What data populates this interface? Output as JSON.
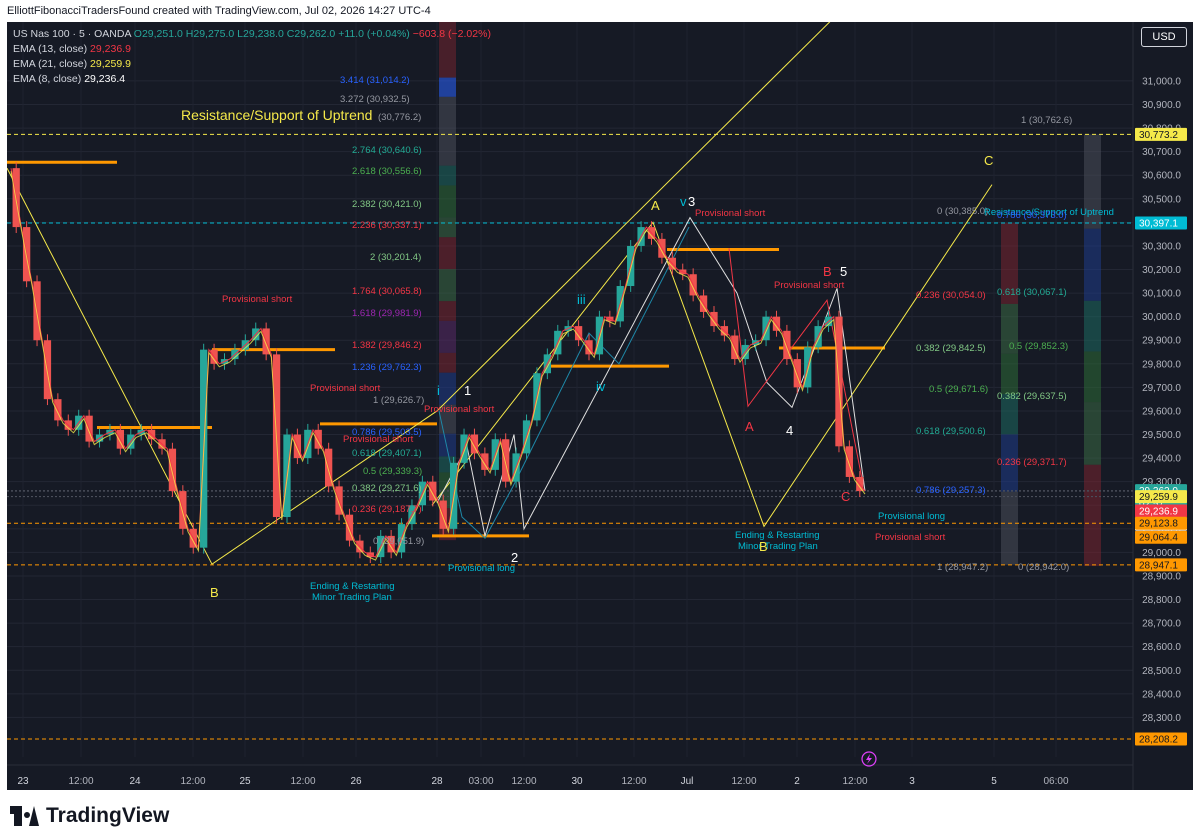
{
  "header": {
    "caption": "ElliottFibonacciTradersFound created with TradingView.com, Jul 02, 2026 14:27 UTC-4"
  },
  "legend": {
    "symbol": "US Nas 100 · 5 · OANDA",
    "ohlc": {
      "o": "O29,251.0",
      "h": "H29,275.0",
      "l": "L29,238.0",
      "c": "C29,262.0",
      "chg": "+11.0 (+0.04%)",
      "chg2": "−603.8 (−2.02%)"
    },
    "emas": [
      {
        "label": "EMA (13, close)",
        "value": "29,236.9",
        "color": "#f23645"
      },
      {
        "label": "EMA (21, close)",
        "value": "29,259.9",
        "color": "#f5e94a"
      },
      {
        "label": "EMA (8, close)",
        "value": "29,236.4",
        "color": "#ffffff"
      }
    ]
  },
  "currency_button": "USD",
  "colors": {
    "bg": "#161a25",
    "up": "#26a69a",
    "down": "#ef5350",
    "yellow": "#f5e94a",
    "orange": "#ff9800",
    "red": "#f23645",
    "blue": "#2962ff",
    "cyan": "#22ab94"
  },
  "footer": {
    "brand": "TradingView"
  },
  "chart_data": {
    "type": "line",
    "title": "",
    "ylim": [
      28132,
      31250
    ],
    "y_ticks": [
      "31,000.0",
      "30,900.0",
      "30,800.0",
      "30,700.0",
      "30,600.0",
      "30,500.0",
      "30,400.0",
      "30,300.0",
      "30,200.0",
      "30,100.0",
      "30,000.0",
      "29,900.0",
      "29,800.0",
      "29,700.0",
      "29,600.0",
      "29,500.0",
      "29,400.0",
      "29,300.0",
      "29,200.0",
      "29,100.0",
      "29,000.0",
      "28,900.0",
      "28,800.0",
      "28,700.0",
      "28,600.0",
      "28,500.0",
      "28,400.0",
      "28,300.0"
    ],
    "x_ticks": [
      "23",
      "12:00",
      "24",
      "12:00",
      "25",
      "12:00",
      "26",
      "28",
      "03:00",
      "12:00",
      "30",
      "12:00",
      "Jul",
      "12:00",
      "2",
      "12:00",
      "3",
      "5",
      "06:00"
    ],
    "price_series": {
      "name": "US Nas 100",
      "values": [
        30630,
        30380,
        30150,
        29900,
        29650,
        29560,
        29520,
        29580,
        29470,
        29500,
        29520,
        29440,
        29500,
        29520,
        29480,
        29440,
        29260,
        29100,
        29020,
        29860,
        29800,
        29820,
        29860,
        29900,
        29950,
        29840,
        29150,
        29500,
        29400,
        29520,
        29440,
        29280,
        29160,
        29050,
        29000,
        28980,
        29070,
        29000,
        29120,
        29200,
        29300,
        29220,
        29100,
        29380,
        29500,
        29420,
        29350,
        29480,
        29300,
        29420,
        29560,
        29760,
        29840,
        29940,
        29960,
        29900,
        29840,
        30000,
        29980,
        30130,
        30300,
        30380,
        30330,
        30250,
        30200,
        30180,
        30090,
        30020,
        29960,
        29920,
        29820,
        29880,
        29900,
        30000,
        29940,
        29820,
        29700,
        29870,
        29960,
        30000,
        29450,
        29320,
        29260
      ]
    },
    "horizontal_levels": [
      {
        "label": "",
        "value": 30773.2,
        "badge": "30,773.2",
        "style": "dashed-yellow"
      },
      {
        "label": "",
        "value": 30397.1,
        "badge": "30,397.1",
        "style": "dashed-cyan"
      },
      {
        "label": "",
        "value": 29262.0,
        "badge": "29,262.0",
        "badge2": "02:57",
        "style": "price"
      },
      {
        "label": "",
        "value": 29259.9,
        "badge": "29,259.9",
        "style": "ema21"
      },
      {
        "label": "",
        "value": 29236.9,
        "badge": "29,236.9",
        "style": "ema13"
      },
      {
        "label": "",
        "value": 29236.4,
        "badge": "29,236.4",
        "style": "ema8"
      },
      {
        "label": "",
        "value": 29123.8,
        "badge": "29,123.8",
        "style": "dashed-orange"
      },
      {
        "label": "",
        "value": 29064.4,
        "badge": "29,064.4",
        "style": "orange"
      },
      {
        "label": "",
        "value": 28947.1,
        "badge": "28,947.1",
        "style": "dashed-orange"
      },
      {
        "label": "",
        "value": 28208.2,
        "badge": "28,208.2",
        "style": "dashed-orange"
      }
    ],
    "text_annotations": [
      {
        "text": "Resistance/Support of Uptrend",
        "color": "#f5e94a"
      },
      {
        "text": "3.414 (31,014.2)",
        "color": "#2962ff"
      },
      {
        "text": "3.272 (30,932.5)",
        "color": "#9598a1"
      },
      {
        "text": "(30,776.2)",
        "color": "#9598a1"
      },
      {
        "text": "2.764 (30,640.6)",
        "color": "#22ab94"
      },
      {
        "text": "2.618 (30,556.6)",
        "color": "#4caf50"
      },
      {
        "text": "2.382 (30,421.0)",
        "color": "#81c784"
      },
      {
        "text": "2.236 (30,337.1)",
        "color": "#f23645"
      },
      {
        "text": "2 (30,201.4)",
        "color": "#81c784"
      },
      {
        "text": "1.764 (30,065.8)",
        "color": "#f23645"
      },
      {
        "text": "1.618 (29,981.9)",
        "color": "#9c27b0"
      },
      {
        "text": "1.382 (29,846.2)",
        "color": "#f23645"
      },
      {
        "text": "1.236 (29,762.3)",
        "color": "#2962ff"
      },
      {
        "text": "1 (29,626.7)",
        "color": "#9598a1"
      },
      {
        "text": "0.786 (29,503.5)",
        "color": "#2962ff"
      },
      {
        "text": "0.618 (29,407.1)",
        "color": "#22ab94"
      },
      {
        "text": "0.5 (29,339.3)",
        "color": "#4caf50"
      },
      {
        "text": "0.382 (29,271.6)",
        "color": "#81c784"
      },
      {
        "text": "0.236 (29,187.7)",
        "color": "#f23645"
      },
      {
        "text": "0 (29,051.9)",
        "color": "#9598a1"
      },
      {
        "text": "Provisional short",
        "color": "#f23645"
      },
      {
        "text": "Provisional short",
        "color": "#f23645"
      },
      {
        "text": "Provisional short",
        "color": "#f23645"
      },
      {
        "text": "Provisional short",
        "color": "#f23645"
      },
      {
        "text": "Provisional short",
        "color": "#f23645"
      },
      {
        "text": "Provisional short",
        "color": "#f23645"
      },
      {
        "text": "Provisional short",
        "color": "#f23645"
      },
      {
        "text": "Provisional long",
        "color": "#00bcd4"
      },
      {
        "text": "Provisional long",
        "color": "#00bcd4"
      },
      {
        "text": "Ending & Restarting",
        "color": "#00bcd4"
      },
      {
        "text": "Minor Trading Plan",
        "color": "#00bcd4"
      },
      {
        "text": "Ending & Restarting",
        "color": "#00bcd4"
      },
      {
        "text": "Minor Trading Plan",
        "color": "#00bcd4"
      },
      {
        "text": "1 (30,762.6)",
        "color": "#9598a1"
      },
      {
        "text": "0 (30,385.0)",
        "color": "#9598a1"
      },
      {
        "text": "Resistance/Support of Uptrend",
        "color": "#00bcd4"
      },
      {
        "text": "0.236 (30,054.0)",
        "color": "#f23645"
      },
      {
        "text": "0.382 (29,842.5)",
        "color": "#81c784"
      },
      {
        "text": "0.5 (29,671.6)",
        "color": "#4caf50"
      },
      {
        "text": "0.618 (29,500.6)",
        "color": "#22ab94"
      },
      {
        "text": "0.786 (29,257.3)",
        "color": "#2962ff"
      },
      {
        "text": "1 (28,947.2)",
        "color": "#9598a1"
      },
      {
        "text": "0.618 (30,067.1)",
        "color": "#22ab94"
      },
      {
        "text": "0.5 (29,852.3)",
        "color": "#4caf50"
      },
      {
        "text": "0.382 (29,637.5)",
        "color": "#81c784"
      },
      {
        "text": "0.236 (29,371.7)",
        "color": "#f23645"
      },
      {
        "text": "0 (28,942.0)",
        "color": "#9598a1"
      },
      {
        "text": "0.786 (30,373.0)",
        "color": "#2962ff"
      }
    ],
    "wave_labels": [
      {
        "text": "B",
        "color": "#f5e94a"
      },
      {
        "text": "i",
        "color": "#00bcd4"
      },
      {
        "text": "1",
        "color": "#ffffff"
      },
      {
        "text": "2",
        "color": "#ffffff"
      },
      {
        "text": "iii",
        "color": "#00bcd4"
      },
      {
        "text": "iv",
        "color": "#00bcd4"
      },
      {
        "text": "A",
        "color": "#f5e94a"
      },
      {
        "text": "v",
        "color": "#00bcd4"
      },
      {
        "text": "3",
        "color": "#ffffff"
      },
      {
        "text": "A",
        "color": "#f23645"
      },
      {
        "text": "4",
        "color": "#ffffff"
      },
      {
        "text": "B",
        "color": "#f23645"
      },
      {
        "text": "5",
        "color": "#ffffff"
      },
      {
        "text": "C",
        "color": "#f23645"
      },
      {
        "text": "B",
        "color": "#f5e94a"
      },
      {
        "text": "C",
        "color": "#f5e94a"
      }
    ]
  }
}
